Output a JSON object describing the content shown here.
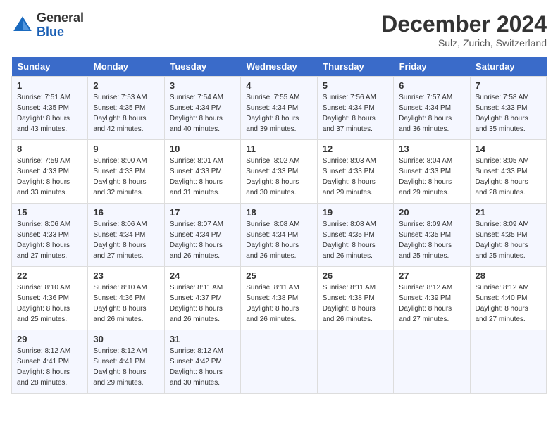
{
  "logo": {
    "text_general": "General",
    "text_blue": "Blue"
  },
  "title": "December 2024",
  "subtitle": "Sulz, Zurich, Switzerland",
  "days_of_week": [
    "Sunday",
    "Monday",
    "Tuesday",
    "Wednesday",
    "Thursday",
    "Friday",
    "Saturday"
  ],
  "weeks": [
    [
      {
        "day": "1",
        "sunrise": "Sunrise: 7:51 AM",
        "sunset": "Sunset: 4:35 PM",
        "daylight": "Daylight: 8 hours and 43 minutes."
      },
      {
        "day": "2",
        "sunrise": "Sunrise: 7:53 AM",
        "sunset": "Sunset: 4:35 PM",
        "daylight": "Daylight: 8 hours and 42 minutes."
      },
      {
        "day": "3",
        "sunrise": "Sunrise: 7:54 AM",
        "sunset": "Sunset: 4:34 PM",
        "daylight": "Daylight: 8 hours and 40 minutes."
      },
      {
        "day": "4",
        "sunrise": "Sunrise: 7:55 AM",
        "sunset": "Sunset: 4:34 PM",
        "daylight": "Daylight: 8 hours and 39 minutes."
      },
      {
        "day": "5",
        "sunrise": "Sunrise: 7:56 AM",
        "sunset": "Sunset: 4:34 PM",
        "daylight": "Daylight: 8 hours and 37 minutes."
      },
      {
        "day": "6",
        "sunrise": "Sunrise: 7:57 AM",
        "sunset": "Sunset: 4:34 PM",
        "daylight": "Daylight: 8 hours and 36 minutes."
      },
      {
        "day": "7",
        "sunrise": "Sunrise: 7:58 AM",
        "sunset": "Sunset: 4:33 PM",
        "daylight": "Daylight: 8 hours and 35 minutes."
      }
    ],
    [
      {
        "day": "8",
        "sunrise": "Sunrise: 7:59 AM",
        "sunset": "Sunset: 4:33 PM",
        "daylight": "Daylight: 8 hours and 33 minutes."
      },
      {
        "day": "9",
        "sunrise": "Sunrise: 8:00 AM",
        "sunset": "Sunset: 4:33 PM",
        "daylight": "Daylight: 8 hours and 32 minutes."
      },
      {
        "day": "10",
        "sunrise": "Sunrise: 8:01 AM",
        "sunset": "Sunset: 4:33 PM",
        "daylight": "Daylight: 8 hours and 31 minutes."
      },
      {
        "day": "11",
        "sunrise": "Sunrise: 8:02 AM",
        "sunset": "Sunset: 4:33 PM",
        "daylight": "Daylight: 8 hours and 30 minutes."
      },
      {
        "day": "12",
        "sunrise": "Sunrise: 8:03 AM",
        "sunset": "Sunset: 4:33 PM",
        "daylight": "Daylight: 8 hours and 29 minutes."
      },
      {
        "day": "13",
        "sunrise": "Sunrise: 8:04 AM",
        "sunset": "Sunset: 4:33 PM",
        "daylight": "Daylight: 8 hours and 29 minutes."
      },
      {
        "day": "14",
        "sunrise": "Sunrise: 8:05 AM",
        "sunset": "Sunset: 4:33 PM",
        "daylight": "Daylight: 8 hours and 28 minutes."
      }
    ],
    [
      {
        "day": "15",
        "sunrise": "Sunrise: 8:06 AM",
        "sunset": "Sunset: 4:33 PM",
        "daylight": "Daylight: 8 hours and 27 minutes."
      },
      {
        "day": "16",
        "sunrise": "Sunrise: 8:06 AM",
        "sunset": "Sunset: 4:34 PM",
        "daylight": "Daylight: 8 hours and 27 minutes."
      },
      {
        "day": "17",
        "sunrise": "Sunrise: 8:07 AM",
        "sunset": "Sunset: 4:34 PM",
        "daylight": "Daylight: 8 hours and 26 minutes."
      },
      {
        "day": "18",
        "sunrise": "Sunrise: 8:08 AM",
        "sunset": "Sunset: 4:34 PM",
        "daylight": "Daylight: 8 hours and 26 minutes."
      },
      {
        "day": "19",
        "sunrise": "Sunrise: 8:08 AM",
        "sunset": "Sunset: 4:35 PM",
        "daylight": "Daylight: 8 hours and 26 minutes."
      },
      {
        "day": "20",
        "sunrise": "Sunrise: 8:09 AM",
        "sunset": "Sunset: 4:35 PM",
        "daylight": "Daylight: 8 hours and 25 minutes."
      },
      {
        "day": "21",
        "sunrise": "Sunrise: 8:09 AM",
        "sunset": "Sunset: 4:35 PM",
        "daylight": "Daylight: 8 hours and 25 minutes."
      }
    ],
    [
      {
        "day": "22",
        "sunrise": "Sunrise: 8:10 AM",
        "sunset": "Sunset: 4:36 PM",
        "daylight": "Daylight: 8 hours and 25 minutes."
      },
      {
        "day": "23",
        "sunrise": "Sunrise: 8:10 AM",
        "sunset": "Sunset: 4:36 PM",
        "daylight": "Daylight: 8 hours and 26 minutes."
      },
      {
        "day": "24",
        "sunrise": "Sunrise: 8:11 AM",
        "sunset": "Sunset: 4:37 PM",
        "daylight": "Daylight: 8 hours and 26 minutes."
      },
      {
        "day": "25",
        "sunrise": "Sunrise: 8:11 AM",
        "sunset": "Sunset: 4:38 PM",
        "daylight": "Daylight: 8 hours and 26 minutes."
      },
      {
        "day": "26",
        "sunrise": "Sunrise: 8:11 AM",
        "sunset": "Sunset: 4:38 PM",
        "daylight": "Daylight: 8 hours and 26 minutes."
      },
      {
        "day": "27",
        "sunrise": "Sunrise: 8:12 AM",
        "sunset": "Sunset: 4:39 PM",
        "daylight": "Daylight: 8 hours and 27 minutes."
      },
      {
        "day": "28",
        "sunrise": "Sunrise: 8:12 AM",
        "sunset": "Sunset: 4:40 PM",
        "daylight": "Daylight: 8 hours and 27 minutes."
      }
    ],
    [
      {
        "day": "29",
        "sunrise": "Sunrise: 8:12 AM",
        "sunset": "Sunset: 4:41 PM",
        "daylight": "Daylight: 8 hours and 28 minutes."
      },
      {
        "day": "30",
        "sunrise": "Sunrise: 8:12 AM",
        "sunset": "Sunset: 4:41 PM",
        "daylight": "Daylight: 8 hours and 29 minutes."
      },
      {
        "day": "31",
        "sunrise": "Sunrise: 8:12 AM",
        "sunset": "Sunset: 4:42 PM",
        "daylight": "Daylight: 8 hours and 30 minutes."
      },
      {
        "day": "",
        "sunrise": "",
        "sunset": "",
        "daylight": ""
      },
      {
        "day": "",
        "sunrise": "",
        "sunset": "",
        "daylight": ""
      },
      {
        "day": "",
        "sunrise": "",
        "sunset": "",
        "daylight": ""
      },
      {
        "day": "",
        "sunrise": "",
        "sunset": "",
        "daylight": ""
      }
    ]
  ]
}
